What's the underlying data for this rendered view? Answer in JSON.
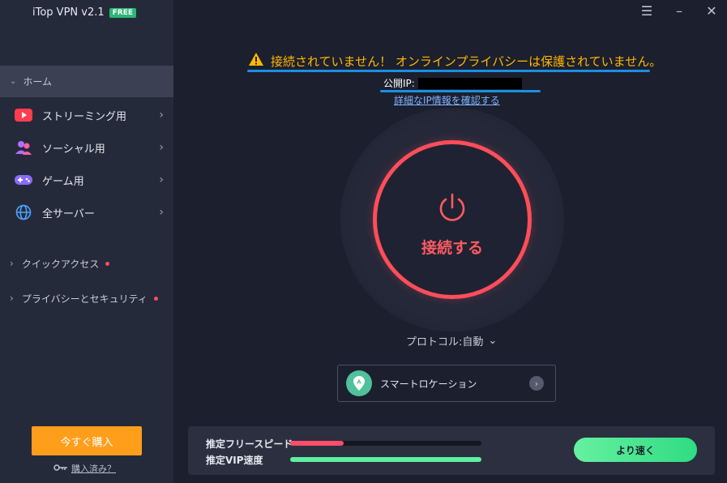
{
  "app": {
    "title": "iTop VPN v2.1",
    "badge": "FREE"
  },
  "window_controls": [
    "menu-icon",
    "minimize-icon",
    "close-icon"
  ],
  "sidebar": {
    "home_label": "ホーム",
    "items": [
      {
        "label": "ストリーミング用",
        "icon": "youtube-icon"
      },
      {
        "label": "ソーシャル用",
        "icon": "social-people-icon"
      },
      {
        "label": "ゲーム用",
        "icon": "gamepad-icon"
      },
      {
        "label": "全サーバー",
        "icon": "globe-icon"
      }
    ],
    "sections": [
      {
        "label": "クイックアクセス"
      },
      {
        "label": "プライバシーとセキュリティ"
      }
    ],
    "buy_label": "今すぐ購入",
    "purchased_label": "購入済み？"
  },
  "main": {
    "warning": "接続されていません！ オンラインプライバシーは保護されていません。",
    "public_ip_label": "公開IP:",
    "ip_detail_link": "詳細なIP情報を確認する",
    "connect_label": "接続する",
    "protocol_label": "プロトコル:自動",
    "smart_location_label": "スマートロケーション"
  },
  "speed": {
    "free_label": "推定フリースピード",
    "vip_label": "推定VIP速度",
    "free_level": 0.28,
    "vip_level": 1.0,
    "faster_button": "より速く"
  },
  "colors": {
    "accent_red": "#ff4d5a",
    "warning_yellow": "#ffb800",
    "buy_orange": "#ff9e1b",
    "green": "#2fdc82"
  }
}
